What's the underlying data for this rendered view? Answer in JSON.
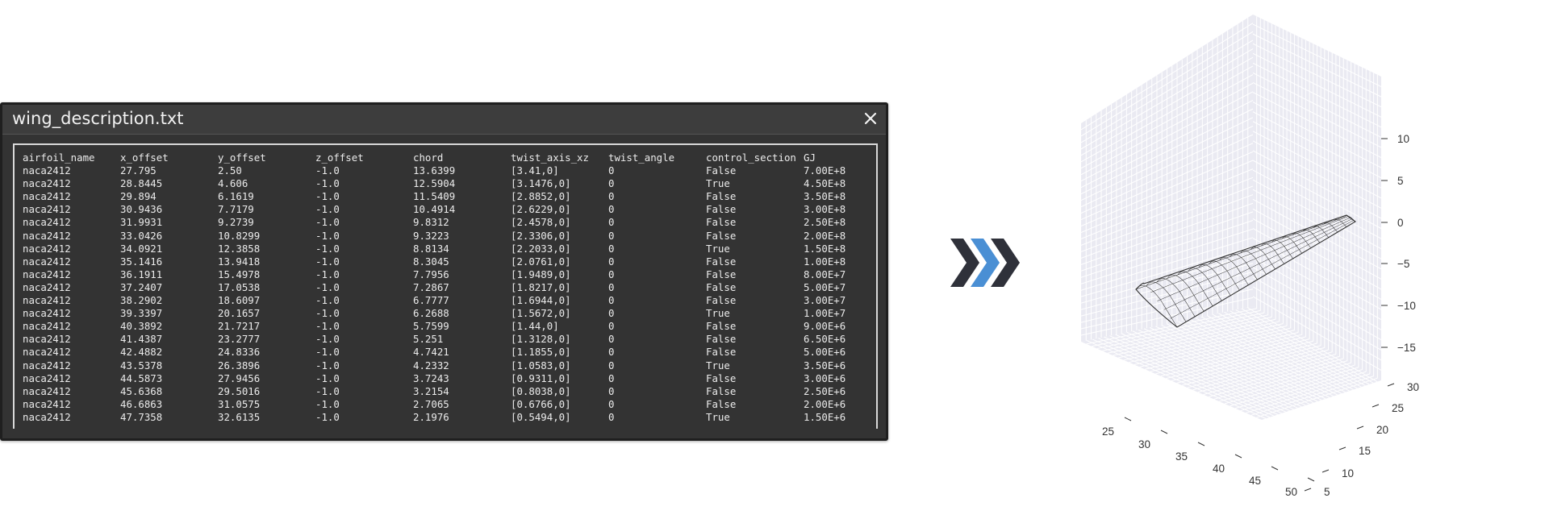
{
  "window": {
    "title": "wing_description.txt",
    "close_icon": "close-icon"
  },
  "table": {
    "headers": [
      "airfoil_name",
      "x_offset",
      "y_offset",
      "z_offset",
      "chord",
      "twist_axis_xz",
      "twist_angle",
      "control_section",
      "GJ"
    ],
    "rows": [
      [
        "naca2412",
        "27.795",
        "2.50",
        "-1.0",
        "13.6399",
        "[3.41,0]",
        "0",
        "False",
        "7.00E+8"
      ],
      [
        "naca2412",
        "28.8445",
        "4.606",
        "-1.0",
        "12.5904",
        "[3.1476,0]",
        "0",
        "True",
        "4.50E+8"
      ],
      [
        "naca2412",
        "29.894",
        "6.1619",
        "-1.0",
        "11.5409",
        "[2.8852,0]",
        "0",
        "False",
        "3.50E+8"
      ],
      [
        "naca2412",
        "30.9436",
        "7.7179",
        "-1.0",
        "10.4914",
        "[2.6229,0]",
        "0",
        "False",
        "3.00E+8"
      ],
      [
        "naca2412",
        "31.9931",
        "9.2739",
        "-1.0",
        "9.8312",
        "[2.4578,0]",
        "0",
        "False",
        "2.50E+8"
      ],
      [
        "naca2412",
        "33.0426",
        "10.8299",
        "-1.0",
        "9.3223",
        "[2.3306,0]",
        "0",
        "False",
        "2.00E+8"
      ],
      [
        "naca2412",
        "34.0921",
        "12.3858",
        "-1.0",
        "8.8134",
        "[2.2033,0]",
        "0",
        "True",
        "1.50E+8"
      ],
      [
        "naca2412",
        "35.1416",
        "13.9418",
        "-1.0",
        "8.3045",
        "[2.0761,0]",
        "0",
        "False",
        "1.00E+8"
      ],
      [
        "naca2412",
        "36.1911",
        "15.4978",
        "-1.0",
        "7.7956",
        "[1.9489,0]",
        "0",
        "False",
        "8.00E+7"
      ],
      [
        "naca2412",
        "37.2407",
        "17.0538",
        "-1.0",
        "7.2867",
        "[1.8217,0]",
        "0",
        "False",
        "5.00E+7"
      ],
      [
        "naca2412",
        "38.2902",
        "18.6097",
        "-1.0",
        "6.7777",
        "[1.6944,0]",
        "0",
        "False",
        "3.00E+7"
      ],
      [
        "naca2412",
        "39.3397",
        "20.1657",
        "-1.0",
        "6.2688",
        "[1.5672,0]",
        "0",
        "True",
        "1.00E+7"
      ],
      [
        "naca2412",
        "40.3892",
        "21.7217",
        "-1.0",
        "5.7599",
        "[1.44,0]",
        "0",
        "False",
        "9.00E+6"
      ],
      [
        "naca2412",
        "41.4387",
        "23.2777",
        "-1.0",
        "5.251",
        "[1.3128,0]",
        "0",
        "False",
        "6.50E+6"
      ],
      [
        "naca2412",
        "42.4882",
        "24.8336",
        "-1.0",
        "4.7421",
        "[1.1855,0]",
        "0",
        "False",
        "5.00E+6"
      ],
      [
        "naca2412",
        "43.5378",
        "26.3896",
        "-1.0",
        "4.2332",
        "[1.0583,0]",
        "0",
        "True",
        "3.50E+6"
      ],
      [
        "naca2412",
        "44.5873",
        "27.9456",
        "-1.0",
        "3.7243",
        "[0.9311,0]",
        "0",
        "False",
        "3.00E+6"
      ],
      [
        "naca2412",
        "45.6368",
        "29.5016",
        "-1.0",
        "3.2154",
        "[0.8038,0]",
        "0",
        "False",
        "2.50E+6"
      ],
      [
        "naca2412",
        "46.6863",
        "31.0575",
        "-1.0",
        "2.7065",
        "[0.6766,0]",
        "0",
        "False",
        "2.00E+6"
      ],
      [
        "naca2412",
        "47.7358",
        "32.6135",
        "-1.0",
        "2.1976",
        "[0.5494,0]",
        "0",
        "True",
        "1.50E+6"
      ]
    ]
  },
  "arrow": {
    "icon": "triple-chevron-right-icon",
    "colors": [
      "#2f313a",
      "#4a8fd4",
      "#2f313a"
    ]
  },
  "plot": {
    "x_ticks": [
      "25",
      "30",
      "35",
      "40",
      "45",
      "50"
    ],
    "y_ticks": [
      "5",
      "10",
      "15",
      "20",
      "25",
      "30"
    ],
    "z_ticks": [
      "10",
      "5",
      "0",
      "−5",
      "−10",
      "−15"
    ],
    "pane_color": "#eaeaf2",
    "grid_color": "#ffffff",
    "wire_color": "#333333"
  }
}
